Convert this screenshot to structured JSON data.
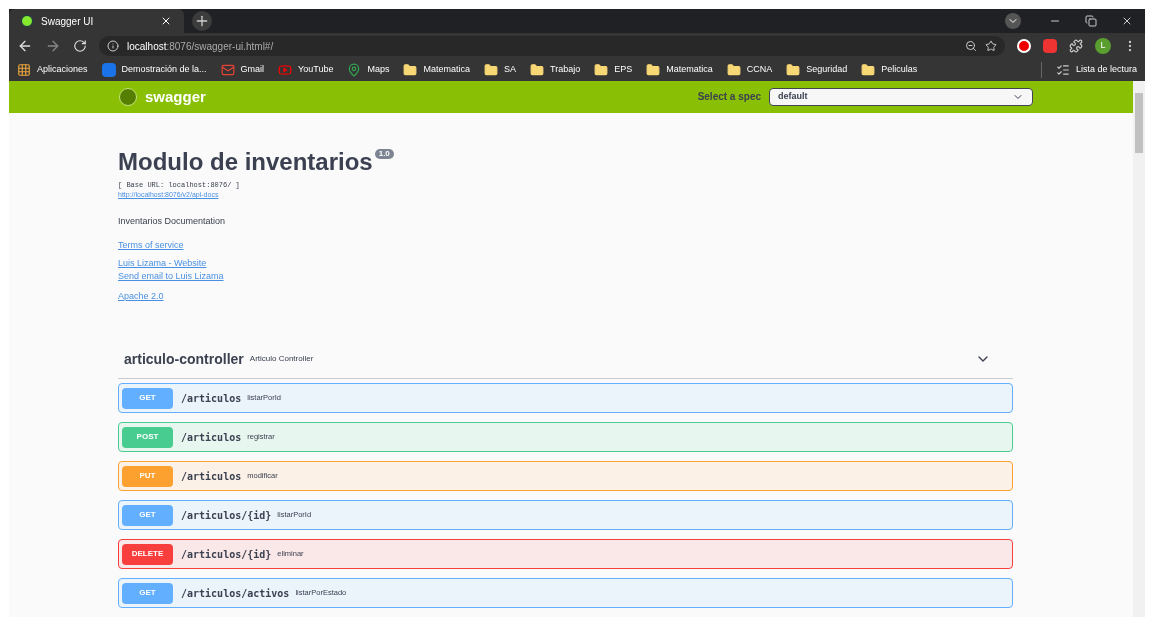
{
  "browser": {
    "tab": {
      "title": "Swagger UI"
    },
    "url_host": "localhost",
    "url_rest": ":8076/swagger-ui.html#/",
    "profile_initial": "L",
    "bookmarks": [
      {
        "label": "Aplicaciones",
        "kind": "apps"
      },
      {
        "label": "Demostración de la...",
        "kind": "tile"
      },
      {
        "label": "Gmail",
        "kind": "mail"
      },
      {
        "label": "YouTube",
        "kind": "video"
      },
      {
        "label": "Maps",
        "kind": "pin"
      },
      {
        "label": "Matematica",
        "kind": "folder"
      },
      {
        "label": "SA",
        "kind": "folder"
      },
      {
        "label": "Trabajo",
        "kind": "folder"
      },
      {
        "label": "EPS",
        "kind": "folder"
      },
      {
        "label": "Matematica",
        "kind": "folder"
      },
      {
        "label": "CCNA",
        "kind": "folder"
      },
      {
        "label": "Seguridad",
        "kind": "folder"
      },
      {
        "label": "Peliculas",
        "kind": "folder"
      }
    ],
    "reading_list": "Lista de lectura"
  },
  "topbar": {
    "logo": "swagger",
    "spec_label": "Select a spec",
    "spec_value": "default"
  },
  "info": {
    "title": "Modulo de inventarios",
    "version": "1.0",
    "base_url": "[ Base URL: localhost:8076/ ]",
    "docs_link": "http://localhost:8076/v2/api-docs",
    "description": "Inventarios Documentation",
    "links": [
      "Terms of service",
      "Luis Lizama - Website",
      "Send email to Luis Lizama",
      "Apache 2.0"
    ]
  },
  "section": {
    "name": "articulo-controller",
    "description": "Articulo Controller",
    "expanded": true,
    "operations": [
      {
        "method": "GET",
        "path": "/articulos",
        "summary": "listarPorId"
      },
      {
        "method": "POST",
        "path": "/articulos",
        "summary": "registrar"
      },
      {
        "method": "PUT",
        "path": "/articulos",
        "summary": "modificar"
      },
      {
        "method": "GET",
        "path": "/articulos/{id}",
        "summary": "listarPorId"
      },
      {
        "method": "DELETE",
        "path": "/articulos/{id}",
        "summary": "eliminar"
      },
      {
        "method": "GET",
        "path": "/articulos/activos",
        "summary": "listarPorEstado"
      }
    ]
  }
}
